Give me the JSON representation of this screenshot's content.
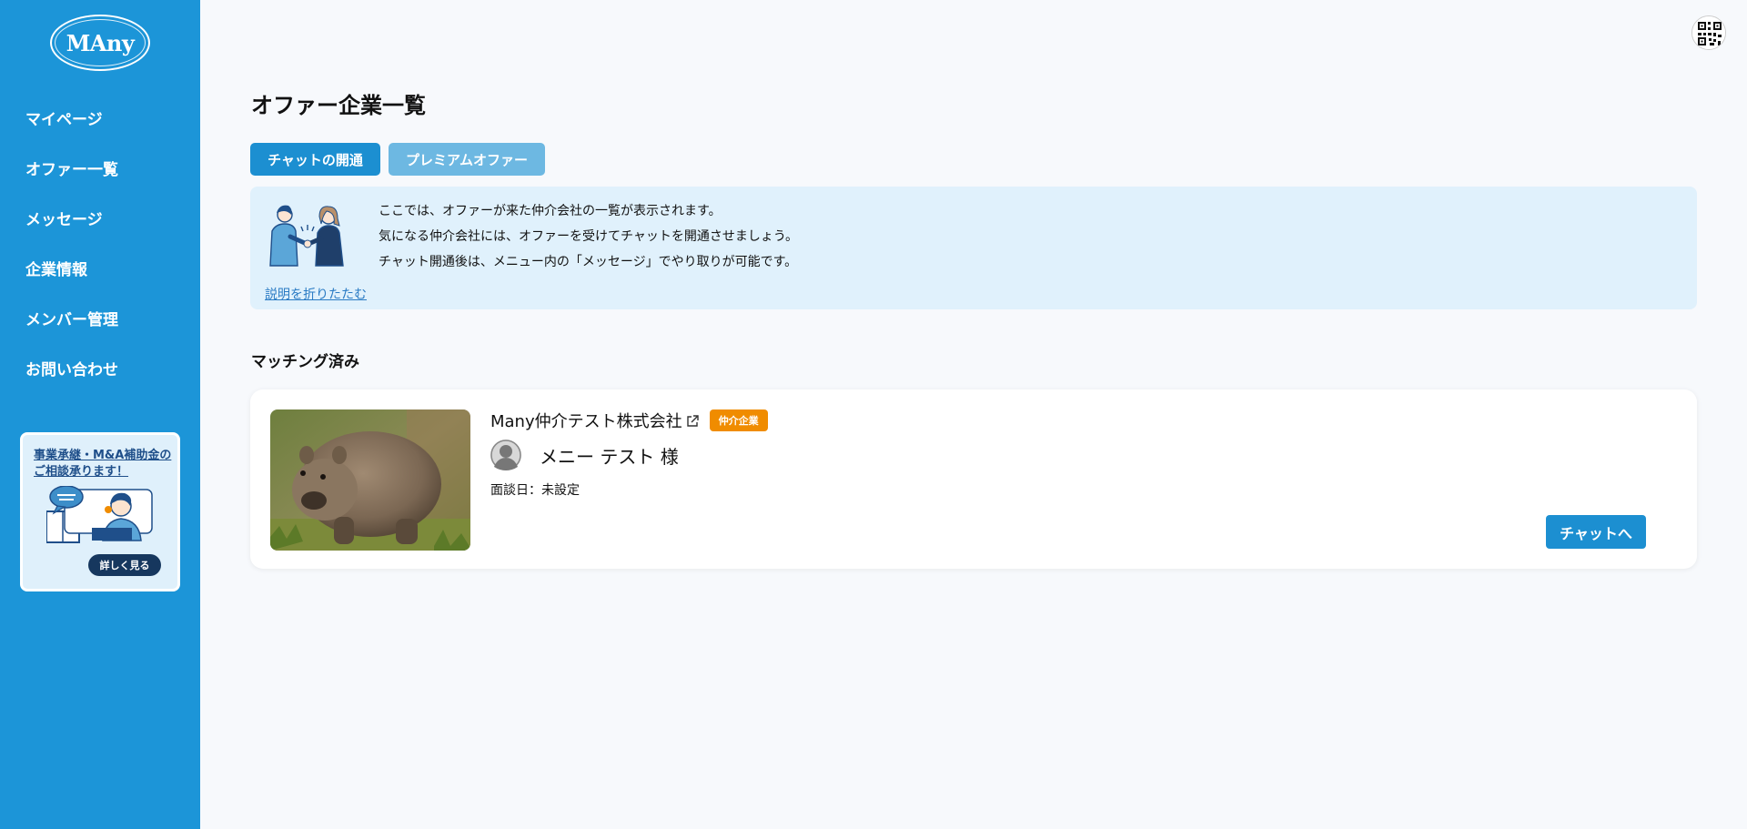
{
  "sidebar": {
    "logo_text": "MAny",
    "items": [
      {
        "label": "マイページ"
      },
      {
        "label": "オファー一覧"
      },
      {
        "label": "メッセージ"
      },
      {
        "label": "企業情報"
      },
      {
        "label": "メンバー管理"
      },
      {
        "label": "お問い合わせ"
      }
    ],
    "banner": {
      "title": "事業承継・M&A補助金のご相談承ります！",
      "button_label": "詳しく見る"
    }
  },
  "header": {
    "avatar_icon": "qr-code-avatar-icon"
  },
  "main": {
    "title": "オファー企業一覧",
    "tabs": [
      {
        "label": "チャットの開通",
        "active": true
      },
      {
        "label": "プレミアムオファー",
        "active": false
      }
    ],
    "info": {
      "lines": [
        "ここでは、オファーが来た仲介会社の一覧が表示されます。",
        "気になる仲介会社には、オファーを受けてチャットを開通させましょう。",
        "チャット開通後は、メニュー内の「メッセージ」でやり取りが可能です。"
      ],
      "collapse_label": "説明を折りたたむ"
    },
    "section_title": "マッチング済み",
    "card": {
      "company_name": "Many仲介テスト株式会社",
      "badge": "仲介企業",
      "person_name": "メニー テスト 様",
      "meeting_date": "面談日：未設定",
      "chat_button": "チャットへ"
    }
  },
  "colors": {
    "sidebar": "#1c95d8",
    "primary_button": "#1c8fd1",
    "secondary_tab": "#6db8e2",
    "badge": "#f08c00",
    "info_bg": "#e0f1fc"
  }
}
